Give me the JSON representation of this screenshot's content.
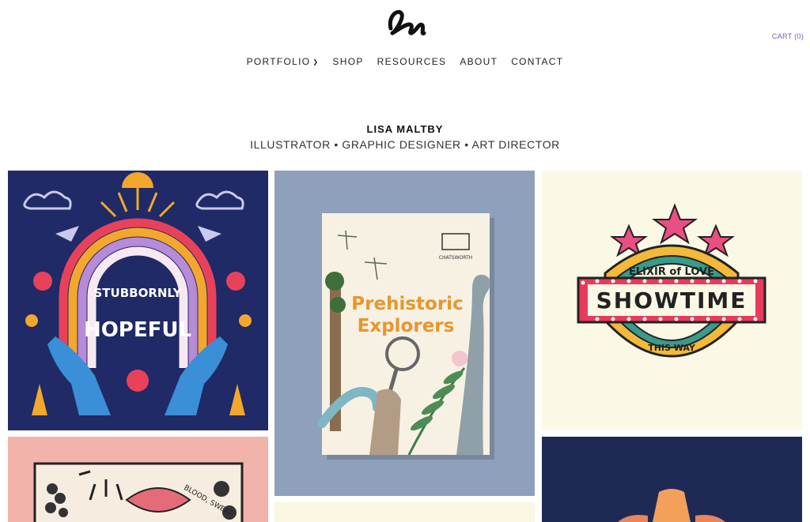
{
  "header": {
    "logo_text": "Lm",
    "cart_label": "CART (0)"
  },
  "nav": {
    "items": [
      {
        "label": "PORTFOLIO",
        "has_dropdown": true
      },
      {
        "label": "SHOP"
      },
      {
        "label": "RESOURCES"
      },
      {
        "label": "ABOUT"
      },
      {
        "label": "CONTACT"
      }
    ]
  },
  "hero": {
    "name": "LISA MALTBY",
    "tagline": "ILLUSTRATOR • GRAPHIC DESIGNER • ART DIRECTOR"
  },
  "portfolio": {
    "tiles": [
      {
        "art_text_1": "STUBBORNLY",
        "art_text_2": "HOPEFUL",
        "background": "#1f2a66"
      },
      {
        "art_text_1": "Prehistoric",
        "art_text_2": "Explorers",
        "art_text_3": "CHATSWORTH",
        "background": "#8fa0ba"
      },
      {
        "art_text_1": "ELIXIR of LOVE",
        "art_text_2": "SHOWTIME",
        "art_text_3": "THIS WAY",
        "background": "#fbf8e6"
      },
      {
        "art_text_1": "BLOOD, SWEAT",
        "background": "#f1b3aa"
      },
      {
        "background": "#fbf6e2"
      },
      {
        "background": "#1e2a55"
      }
    ]
  }
}
